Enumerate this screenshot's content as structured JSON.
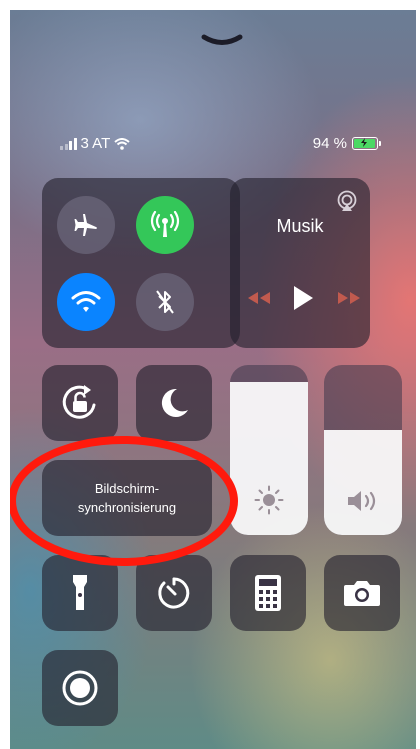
{
  "status_bar": {
    "carrier": "3 AT",
    "battery_percent": "94 %",
    "signal_bars": 2,
    "signal_max": 4,
    "battery_level": 0.94
  },
  "connectivity": {
    "airplane": {
      "icon": "airplane-icon",
      "on": false
    },
    "cellular_data": {
      "icon": "antenna-icon",
      "on": true,
      "color": "#34c759"
    },
    "wifi": {
      "icon": "wifi-icon",
      "on": true,
      "color": "#0a84ff"
    },
    "bluetooth": {
      "icon": "bluetooth-icon",
      "on": false
    }
  },
  "music": {
    "title": "Musik",
    "airplay_icon": "airplay-icon",
    "controls": [
      "rewind-icon",
      "play-icon",
      "fast-forward-icon"
    ]
  },
  "toggles": {
    "rotation_lock": {
      "icon": "rotation-lock-icon"
    },
    "do_not_disturb": {
      "icon": "moon-icon"
    }
  },
  "screen_mirroring": {
    "line1": "Bildschirm-",
    "line2": "synchronisierung"
  },
  "sliders": {
    "brightness": {
      "icon": "sun-icon",
      "level": 0.9
    },
    "volume": {
      "icon": "speaker-icon",
      "level": 0.62
    }
  },
  "shortcuts": [
    "flashlight-icon",
    "timer-icon",
    "calculator-icon",
    "camera-icon",
    "screen-record-icon"
  ],
  "colors": {
    "accent_green": "#34c759",
    "accent_blue": "#0a84ff",
    "annotation_red": "#ff1a0d"
  }
}
